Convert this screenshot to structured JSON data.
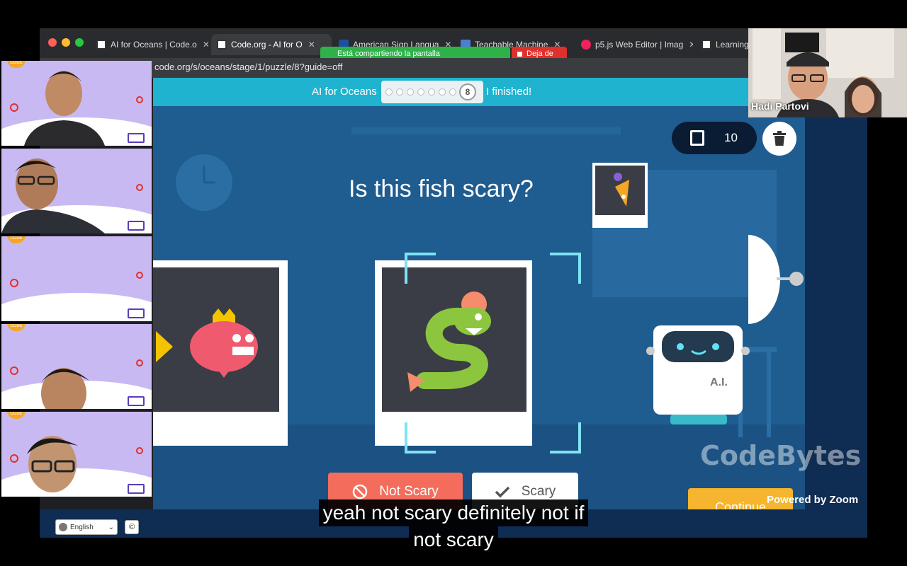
{
  "browser": {
    "tabs": [
      {
        "label": "AI for Oceans | Code.o",
        "active": false
      },
      {
        "label": "Code.org - AI for O",
        "active": true
      },
      {
        "label": "American Sign Langua",
        "active": false
      },
      {
        "label": "Teachable Machine",
        "active": false
      },
      {
        "label": "p5.js Web Editor | Imag",
        "active": false
      },
      {
        "label": "Learning",
        "active": false
      }
    ],
    "url": "code.org/s/oceans/stage/1/puzzle/8?guide=off",
    "share_banner": "Está compartiendo la pantalla",
    "stop_share": "Deja de"
  },
  "game": {
    "title": "AI for Oceans",
    "current_puzzle": "8",
    "finished_label": "I finished!",
    "question": "Is this fish scary?",
    "counter": "10",
    "robot_label": "A.I.",
    "not_scary_label": "Not Scary",
    "scary_label": "Scary",
    "continue_label": "Continue",
    "language": "English",
    "copyright": "©"
  },
  "zoom": {
    "speaker_name": "Hadi Partovi",
    "watermark": "CodeBytes",
    "powered_by": "Powered by Zoom",
    "tiles": [
      {
        "badge": "CODE",
        "has_person": true
      },
      {
        "badge": "",
        "has_person": true
      },
      {
        "badge": "CODE",
        "has_person": false
      },
      {
        "badge": "CODE",
        "has_person": true
      },
      {
        "badge": "CODE",
        "has_person": true
      }
    ]
  },
  "caption": {
    "line1": "yeah not scary definitely not if",
    "line2": "not scary"
  },
  "colors": {
    "accent": "#20b3cf",
    "stage": "#1f5c8f",
    "not_scary": "#f36c5c",
    "continue": "#f5b52e",
    "zoom_green": "#2fb14a"
  }
}
